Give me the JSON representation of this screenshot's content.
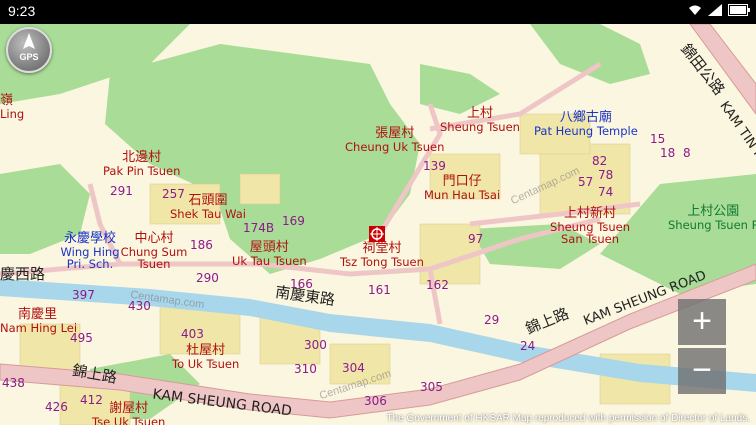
{
  "status_bar": {
    "time": "9:23",
    "icons": [
      "wifi-icon",
      "signal-icon",
      "battery-icon"
    ]
  },
  "controls": {
    "gps_label": "GPS",
    "zoom_in_label": "+",
    "zoom_out_label": "−"
  },
  "places": [
    {
      "cn": "張屋村",
      "en": "Cheung Uk Tsuen"
    },
    {
      "cn": "上村",
      "en": "Sheung Tsuen"
    },
    {
      "cn": "八鄉古廟",
      "en": "Pat Heung Temple"
    },
    {
      "cn": "門口仔",
      "en": "Mun Hau Tsai"
    },
    {
      "cn": "北邊村",
      "en": "Pak Pin Tsuen"
    },
    {
      "cn": "石頭圍",
      "en": "Shek Tau Wai"
    },
    {
      "cn": "上村新村",
      "en": "Sheung Tsuen San Tsuen"
    },
    {
      "cn": "上村公園",
      "en": "Sheung Tsuen P"
    },
    {
      "cn": "永慶學校",
      "en": "Wing Hing Pri. Sch."
    },
    {
      "cn": "中心村",
      "en": "Chung Sum Tsuen"
    },
    {
      "cn": "屋頭村",
      "en": "Uk Tau Tsuen"
    },
    {
      "cn": "祠堂村",
      "en": "Tsz Tong Tsuen"
    },
    {
      "cn": "南慶里",
      "en": "Nam Hing Lei"
    },
    {
      "cn": "杜屋村",
      "en": "To Uk Tsuen"
    },
    {
      "cn": "謝屋村",
      "en": "Tse Uk Tsuen"
    },
    {
      "cn": "嶺",
      "en": "Ling"
    }
  ],
  "roads": {
    "nam_hing_east": "南慶東路",
    "kam_sheung_cn_1": "錦上路",
    "kam_sheung_cn_2": "錦上路",
    "kam_sheung_en_1": "KAM SHEUNG ROAD",
    "kam_sheung_en_2": "KAM SHEUNG ROAD",
    "kam_tin_en": "KAM TIN R",
    "kam_tin_cn": "錦田公路",
    "west_road_cn": "慶西路"
  },
  "lot_numbers": [
    "139",
    "82",
    "78",
    "15",
    "18",
    "8",
    "57",
    "74",
    "291",
    "257",
    "169",
    "174B",
    "186",
    "97",
    "290",
    "166",
    "161",
    "162",
    "397",
    "430",
    "495",
    "29",
    "403",
    "300",
    "310",
    "304",
    "24",
    "438",
    "412",
    "426",
    "305",
    "306"
  ],
  "watermarks": [
    "Centamap.com",
    "Centamap.com",
    "Centamap.com"
  ],
  "attribution": "The Government of HKSAR Map reproduced with permission of Director of Lands.",
  "colors": {
    "background": "#fbf6df",
    "green_area": "#a9dc96",
    "river": "#a8d6ea",
    "road": "#efc6c6",
    "building": "#f0e6a8",
    "label_red": "#b01010",
    "label_blue": "#1a33c8",
    "marker": "#cc0000"
  }
}
